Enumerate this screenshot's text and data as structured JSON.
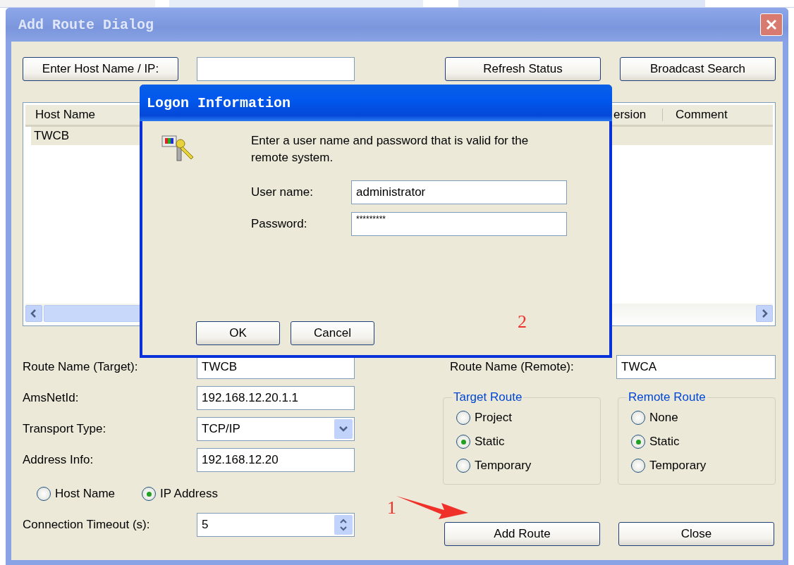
{
  "window": {
    "title": "Add Route Dialog"
  },
  "toolbar": {
    "host_button": "Enter Host Name / IP:",
    "refresh_button": "Refresh Status",
    "broadcast_button": "Broadcast Search"
  },
  "host_list": {
    "columns": [
      "Host Name",
      "ersion",
      "Comment"
    ],
    "rows": [
      {
        "cells": [
          "TWCB"
        ],
        "selected": true
      }
    ]
  },
  "form": [
    {
      "kind": "text",
      "label": "Route Name (Target):",
      "value": "TWCB"
    },
    {
      "kind": "text",
      "label": "AmsNetId:",
      "value": "192.168.12.20.1.1"
    },
    {
      "kind": "dropdown",
      "label": "Transport Type:",
      "value": "TCP/IP"
    },
    {
      "kind": "text",
      "label": "Address Info:",
      "value": "192.168.12.20"
    },
    {
      "kind": "radios",
      "options": [
        {
          "label": "Host Name",
          "selected": false
        },
        {
          "label": "IP Address",
          "selected": true
        }
      ]
    },
    {
      "kind": "spinner",
      "label": "Connection Timeout (s):",
      "value": "5"
    }
  ],
  "remote_name": {
    "label": "Route Name (Remote):",
    "value": "TWCA"
  },
  "groups": [
    {
      "title": "Target Route",
      "options": [
        {
          "label": "Project",
          "selected": false
        },
        {
          "label": "Static",
          "selected": true
        },
        {
          "label": "Temporary",
          "selected": false
        }
      ]
    },
    {
      "title": "Remote Route",
      "options": [
        {
          "label": "None",
          "selected": false
        },
        {
          "label": "Static",
          "selected": true
        },
        {
          "label": "Temporary",
          "selected": false
        }
      ]
    }
  ],
  "buttons": [
    "Add Route",
    "Close"
  ],
  "logon": {
    "title": "Logon Information",
    "message": "Enter a user name and password that is valid for the remote system.",
    "fields": [
      {
        "label": "User name:",
        "value": "administrator"
      },
      {
        "label": "Password:",
        "value": "*********"
      }
    ],
    "buttons": [
      "OK",
      "Cancel"
    ]
  },
  "annotations": [
    {
      "text": "1"
    },
    {
      "text": "2"
    }
  ]
}
